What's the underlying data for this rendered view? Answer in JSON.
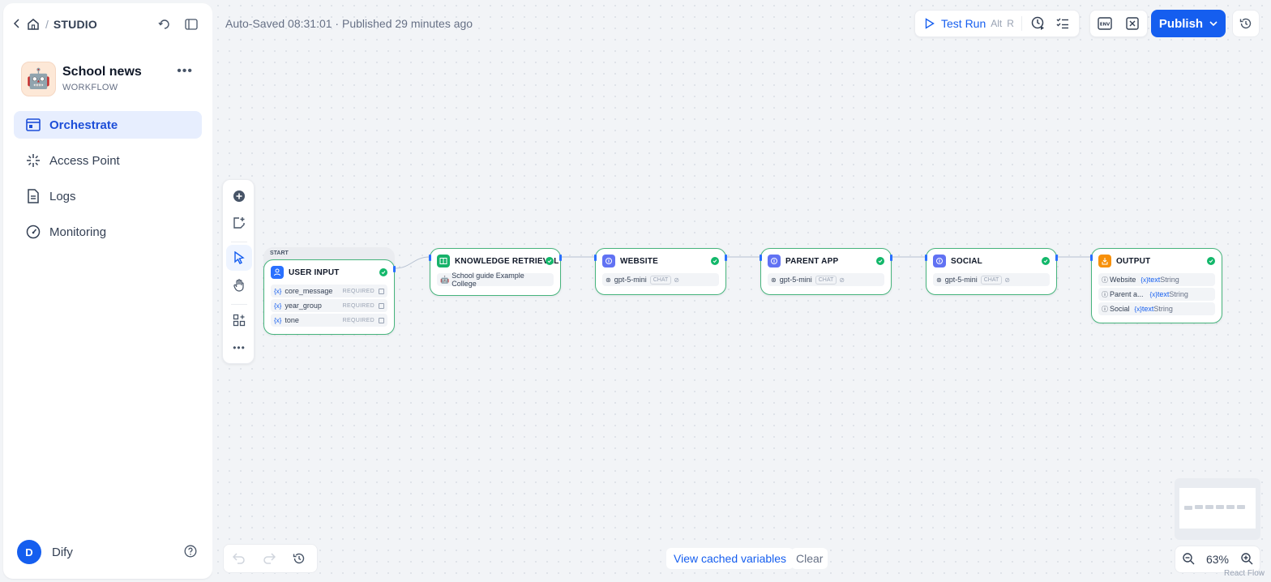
{
  "header": {
    "studio": "STUDIO"
  },
  "app": {
    "name": "School news",
    "type": "WORKFLOW",
    "emoji": "🤖"
  },
  "nav": [
    {
      "label": "Orchestrate",
      "active": true
    },
    {
      "label": "Access Point"
    },
    {
      "label": "Logs"
    },
    {
      "label": "Monitoring"
    }
  ],
  "user": {
    "initial": "D",
    "name": "Dify"
  },
  "status": {
    "text": "Auto-Saved 08:31:01 · Published 29 minutes ago"
  },
  "toolbar": {
    "test_run": "Test Run",
    "kbd_alt": "Alt",
    "kbd_r": "R",
    "publish": "Publish"
  },
  "nodes": {
    "start_tag": "START",
    "user_input": {
      "title": "USER INPUT",
      "vars": [
        {
          "name": "core_message",
          "req": "REQUIRED"
        },
        {
          "name": "year_group",
          "req": "REQUIRED"
        },
        {
          "name": "tone",
          "req": "REQUIRED"
        }
      ]
    },
    "knowledge": {
      "title": "KNOWLEDGE RETRIEVAL",
      "dataset": "School guide Example College"
    },
    "website": {
      "title": "WEBSITE",
      "model": "gpt-5-mini",
      "mode": "CHAT"
    },
    "parent_app": {
      "title": "PARENT APP",
      "model": "gpt-5-mini",
      "mode": "CHAT"
    },
    "social": {
      "title": "SOCIAL",
      "model": "gpt-5-mini",
      "mode": "CHAT"
    },
    "output": {
      "title": "OUTPUT",
      "rows": [
        {
          "name": "Website",
          "var": "{x}",
          "field": "text",
          "type": "String"
        },
        {
          "name": "Parent a...",
          "var": "{x}",
          "field": "text",
          "type": "String"
        },
        {
          "name": "Social",
          "var": "{x}",
          "field": "text",
          "type": "String"
        }
      ]
    }
  },
  "var_token": "{x}",
  "footer": {
    "cached": "View cached variables",
    "clear": "Clear",
    "zoom": "63%",
    "rf": "React Flow"
  },
  "colors": {
    "accent": "#155eef",
    "node_border": "#47b47d",
    "success": "#12b76a",
    "llm_icon": "#6172f3",
    "knowledge_icon": "#17b26a",
    "output_icon": "#f79009",
    "start_icon": "#2970ff"
  }
}
